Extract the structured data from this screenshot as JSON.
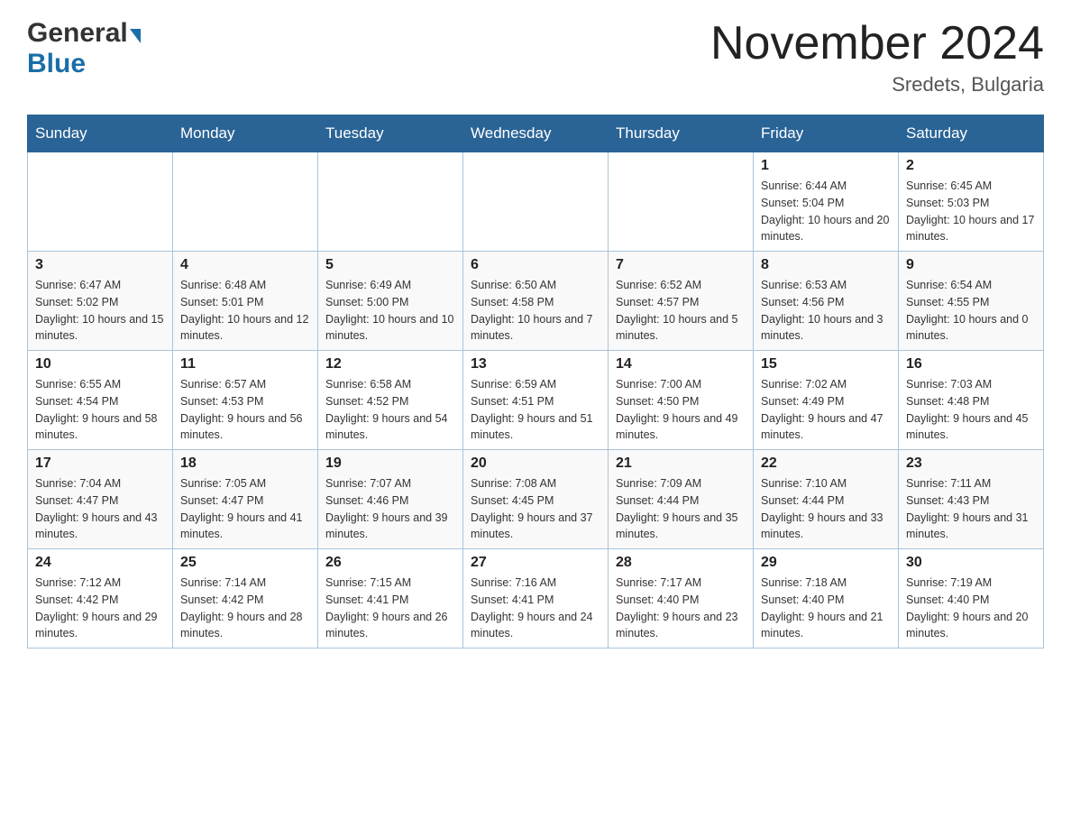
{
  "header": {
    "logo": {
      "general": "General",
      "blue": "Blue",
      "arrow": "▶"
    },
    "title": "November 2024",
    "location": "Sredets, Bulgaria"
  },
  "weekdays": [
    "Sunday",
    "Monday",
    "Tuesday",
    "Wednesday",
    "Thursday",
    "Friday",
    "Saturday"
  ],
  "weeks": [
    [
      {
        "day": "",
        "sunrise": "",
        "sunset": "",
        "daylight": ""
      },
      {
        "day": "",
        "sunrise": "",
        "sunset": "",
        "daylight": ""
      },
      {
        "day": "",
        "sunrise": "",
        "sunset": "",
        "daylight": ""
      },
      {
        "day": "",
        "sunrise": "",
        "sunset": "",
        "daylight": ""
      },
      {
        "day": "",
        "sunrise": "",
        "sunset": "",
        "daylight": ""
      },
      {
        "day": "1",
        "sunrise": "Sunrise: 6:44 AM",
        "sunset": "Sunset: 5:04 PM",
        "daylight": "Daylight: 10 hours and 20 minutes."
      },
      {
        "day": "2",
        "sunrise": "Sunrise: 6:45 AM",
        "sunset": "Sunset: 5:03 PM",
        "daylight": "Daylight: 10 hours and 17 minutes."
      }
    ],
    [
      {
        "day": "3",
        "sunrise": "Sunrise: 6:47 AM",
        "sunset": "Sunset: 5:02 PM",
        "daylight": "Daylight: 10 hours and 15 minutes."
      },
      {
        "day": "4",
        "sunrise": "Sunrise: 6:48 AM",
        "sunset": "Sunset: 5:01 PM",
        "daylight": "Daylight: 10 hours and 12 minutes."
      },
      {
        "day": "5",
        "sunrise": "Sunrise: 6:49 AM",
        "sunset": "Sunset: 5:00 PM",
        "daylight": "Daylight: 10 hours and 10 minutes."
      },
      {
        "day": "6",
        "sunrise": "Sunrise: 6:50 AM",
        "sunset": "Sunset: 4:58 PM",
        "daylight": "Daylight: 10 hours and 7 minutes."
      },
      {
        "day": "7",
        "sunrise": "Sunrise: 6:52 AM",
        "sunset": "Sunset: 4:57 PM",
        "daylight": "Daylight: 10 hours and 5 minutes."
      },
      {
        "day": "8",
        "sunrise": "Sunrise: 6:53 AM",
        "sunset": "Sunset: 4:56 PM",
        "daylight": "Daylight: 10 hours and 3 minutes."
      },
      {
        "day": "9",
        "sunrise": "Sunrise: 6:54 AM",
        "sunset": "Sunset: 4:55 PM",
        "daylight": "Daylight: 10 hours and 0 minutes."
      }
    ],
    [
      {
        "day": "10",
        "sunrise": "Sunrise: 6:55 AM",
        "sunset": "Sunset: 4:54 PM",
        "daylight": "Daylight: 9 hours and 58 minutes."
      },
      {
        "day": "11",
        "sunrise": "Sunrise: 6:57 AM",
        "sunset": "Sunset: 4:53 PM",
        "daylight": "Daylight: 9 hours and 56 minutes."
      },
      {
        "day": "12",
        "sunrise": "Sunrise: 6:58 AM",
        "sunset": "Sunset: 4:52 PM",
        "daylight": "Daylight: 9 hours and 54 minutes."
      },
      {
        "day": "13",
        "sunrise": "Sunrise: 6:59 AM",
        "sunset": "Sunset: 4:51 PM",
        "daylight": "Daylight: 9 hours and 51 minutes."
      },
      {
        "day": "14",
        "sunrise": "Sunrise: 7:00 AM",
        "sunset": "Sunset: 4:50 PM",
        "daylight": "Daylight: 9 hours and 49 minutes."
      },
      {
        "day": "15",
        "sunrise": "Sunrise: 7:02 AM",
        "sunset": "Sunset: 4:49 PM",
        "daylight": "Daylight: 9 hours and 47 minutes."
      },
      {
        "day": "16",
        "sunrise": "Sunrise: 7:03 AM",
        "sunset": "Sunset: 4:48 PM",
        "daylight": "Daylight: 9 hours and 45 minutes."
      }
    ],
    [
      {
        "day": "17",
        "sunrise": "Sunrise: 7:04 AM",
        "sunset": "Sunset: 4:47 PM",
        "daylight": "Daylight: 9 hours and 43 minutes."
      },
      {
        "day": "18",
        "sunrise": "Sunrise: 7:05 AM",
        "sunset": "Sunset: 4:47 PM",
        "daylight": "Daylight: 9 hours and 41 minutes."
      },
      {
        "day": "19",
        "sunrise": "Sunrise: 7:07 AM",
        "sunset": "Sunset: 4:46 PM",
        "daylight": "Daylight: 9 hours and 39 minutes."
      },
      {
        "day": "20",
        "sunrise": "Sunrise: 7:08 AM",
        "sunset": "Sunset: 4:45 PM",
        "daylight": "Daylight: 9 hours and 37 minutes."
      },
      {
        "day": "21",
        "sunrise": "Sunrise: 7:09 AM",
        "sunset": "Sunset: 4:44 PM",
        "daylight": "Daylight: 9 hours and 35 minutes."
      },
      {
        "day": "22",
        "sunrise": "Sunrise: 7:10 AM",
        "sunset": "Sunset: 4:44 PM",
        "daylight": "Daylight: 9 hours and 33 minutes."
      },
      {
        "day": "23",
        "sunrise": "Sunrise: 7:11 AM",
        "sunset": "Sunset: 4:43 PM",
        "daylight": "Daylight: 9 hours and 31 minutes."
      }
    ],
    [
      {
        "day": "24",
        "sunrise": "Sunrise: 7:12 AM",
        "sunset": "Sunset: 4:42 PM",
        "daylight": "Daylight: 9 hours and 29 minutes."
      },
      {
        "day": "25",
        "sunrise": "Sunrise: 7:14 AM",
        "sunset": "Sunset: 4:42 PM",
        "daylight": "Daylight: 9 hours and 28 minutes."
      },
      {
        "day": "26",
        "sunrise": "Sunrise: 7:15 AM",
        "sunset": "Sunset: 4:41 PM",
        "daylight": "Daylight: 9 hours and 26 minutes."
      },
      {
        "day": "27",
        "sunrise": "Sunrise: 7:16 AM",
        "sunset": "Sunset: 4:41 PM",
        "daylight": "Daylight: 9 hours and 24 minutes."
      },
      {
        "day": "28",
        "sunrise": "Sunrise: 7:17 AM",
        "sunset": "Sunset: 4:40 PM",
        "daylight": "Daylight: 9 hours and 23 minutes."
      },
      {
        "day": "29",
        "sunrise": "Sunrise: 7:18 AM",
        "sunset": "Sunset: 4:40 PM",
        "daylight": "Daylight: 9 hours and 21 minutes."
      },
      {
        "day": "30",
        "sunrise": "Sunrise: 7:19 AM",
        "sunset": "Sunset: 4:40 PM",
        "daylight": "Daylight: 9 hours and 20 minutes."
      }
    ]
  ]
}
